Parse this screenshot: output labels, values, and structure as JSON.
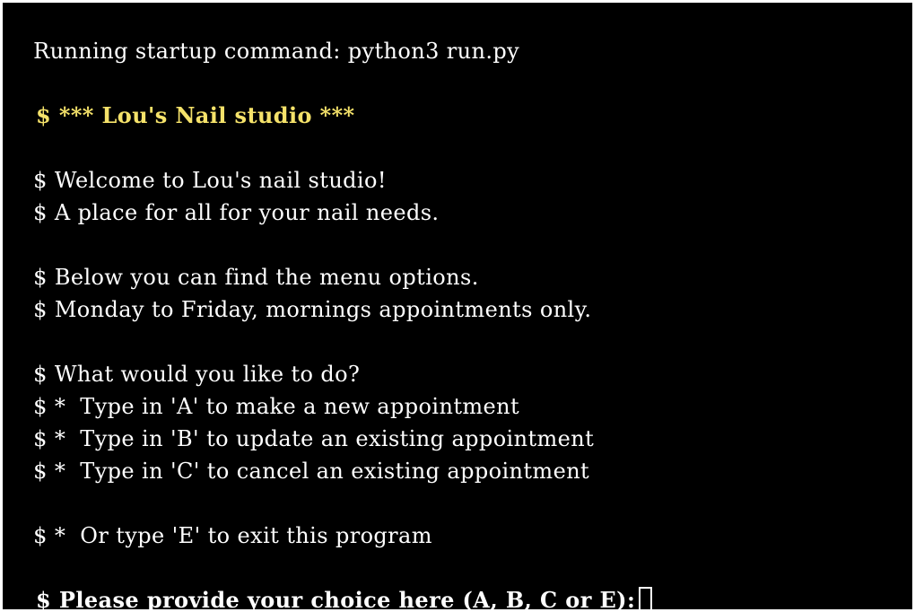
{
  "terminal": {
    "startup_line": "Running startup command: python3 run.py",
    "prompt_symbol": "$",
    "title": "*** Lou's Nail studio ***",
    "welcome": "Welcome to Lou's nail studio!",
    "tagline": "A place for all for your nail needs.",
    "menu_intro": "Below you can find the menu options.",
    "hours": "Monday to Friday, mornings appointments only.",
    "question": "What would you like to do?",
    "options": [
      "*  Type in 'A' to make a new appointment",
      "*  Type in 'B' to update an existing appointment",
      "*  Type in 'C' to cancel an existing appointment"
    ],
    "exit_option": "*  Or type 'E' to exit this program",
    "input_prompt": "Please provide your choice here (A, B, C or E):",
    "input_value": ""
  },
  "colors": {
    "background": "#000000",
    "text": "#ffffff",
    "title": "#f5e26a"
  }
}
